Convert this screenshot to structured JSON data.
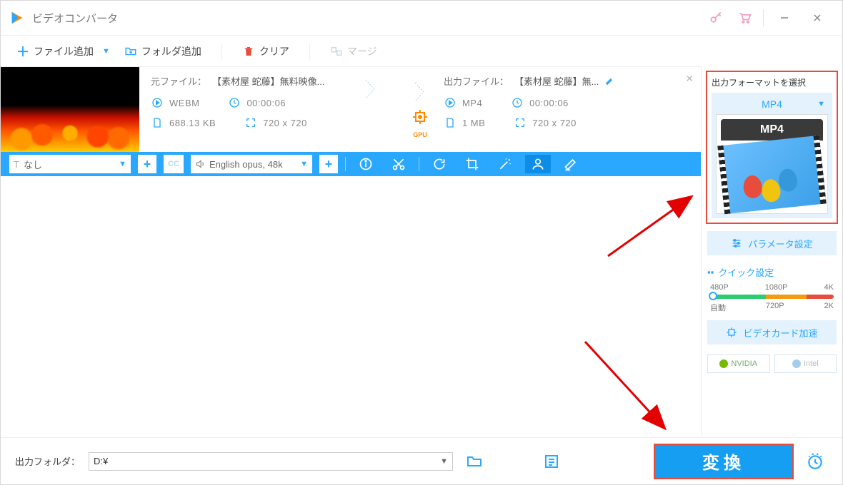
{
  "titlebar": {
    "app_title": "ビデオコンバータ"
  },
  "toolbar": {
    "add_file": "ファイル追加",
    "add_folder": "フォルダ追加",
    "clear": "クリア",
    "merge": "マージ"
  },
  "file_item": {
    "source_label": "元ファイル：",
    "source_name": "【素材屋 蛇藤】無料映像...",
    "output_label": "出力ファイル：",
    "output_name": "【素材屋 蛇藤】無...",
    "src": {
      "format": "WEBM",
      "duration": "00:00:06",
      "size": "688.13 KB",
      "resolution": "720 x 720"
    },
    "out": {
      "format": "MP4",
      "duration": "00:00:06",
      "size": "1 MB",
      "resolution": "720 x 720"
    },
    "gpu_label": "GPU"
  },
  "actionbar": {
    "subtitle_none": "なし",
    "audio_track": "English opus, 48k"
  },
  "right_panel": {
    "title": "出力フォーマットを選択",
    "format_name": "MP4",
    "format_badge": "MP4",
    "param_button": "パラメータ設定",
    "quick_title": "クイック設定",
    "slider_top": [
      "480P",
      "1080P",
      "4K"
    ],
    "slider_bottom": [
      "自動",
      "720P",
      "2K"
    ],
    "hw_button": "ビデオカード加速",
    "nvidia": "NVIDIA",
    "intel": "Intel"
  },
  "bottombar": {
    "out_label": "出力フォルダ：",
    "out_path": "D:¥",
    "convert": "変換"
  }
}
